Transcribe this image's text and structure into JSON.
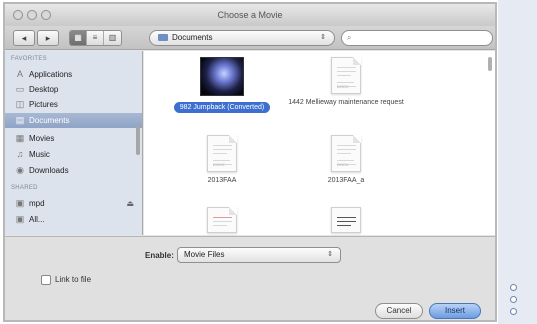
{
  "window": {
    "title": "Choose a Movie"
  },
  "toolbar": {
    "back_icon": "chevron-left-icon",
    "forward_icon": "chevron-right-icon",
    "view_icons": [
      "icon-view-icon",
      "list-view-icon",
      "column-view-icon"
    ],
    "location": "Documents",
    "location_arrows": "⇕",
    "search_icon": "⌕"
  },
  "sidebar": {
    "favorites_header": "FAVORITES",
    "shared_header": "SHARED",
    "favorites": [
      {
        "label": "Applications",
        "icon": "applications-icon",
        "glyph": "A"
      },
      {
        "label": "Desktop",
        "icon": "desktop-icon",
        "glyph": "▭"
      },
      {
        "label": "Pictures",
        "icon": "pictures-icon",
        "glyph": "◫"
      },
      {
        "label": "Documents",
        "icon": "documents-icon",
        "glyph": "▤",
        "selected": true
      },
      {
        "label": "Movies",
        "icon": "movies-icon",
        "glyph": "▦"
      },
      {
        "label": "Music",
        "icon": "music-icon",
        "glyph": "♫"
      },
      {
        "label": "Downloads",
        "icon": "downloads-icon",
        "glyph": "◉"
      }
    ],
    "shared": [
      {
        "label": "mpd",
        "icon": "computer-icon",
        "glyph": "▣",
        "eject": "⏏"
      },
      {
        "label": "All...",
        "icon": "network-icon",
        "glyph": "▣"
      }
    ]
  },
  "files": [
    {
      "name": "982 Jumpback (Converted)",
      "type": "movie",
      "selected": true
    },
    {
      "name": "1442 Mellieway maintenance request",
      "type": "doc",
      "tag": "DOCX"
    },
    {
      "name": "2013FAA",
      "type": "doc",
      "tag": "DOCX"
    },
    {
      "name": "2013FAA_a",
      "type": "doc",
      "tag": "DOCX"
    },
    {
      "name": "",
      "type": "doc"
    },
    {
      "name": "",
      "type": "doc"
    }
  ],
  "bottom": {
    "enable_label": "Enable:",
    "enable_value": "Movie Files",
    "select_arrows": "⇕",
    "link_label": "Link to file",
    "cancel_label": "Cancel",
    "insert_label": "Insert"
  },
  "colors": {
    "accent": "#3c6fcf",
    "sidebar_bg": "#dde3ec",
    "selection": "#8ea3c6"
  }
}
